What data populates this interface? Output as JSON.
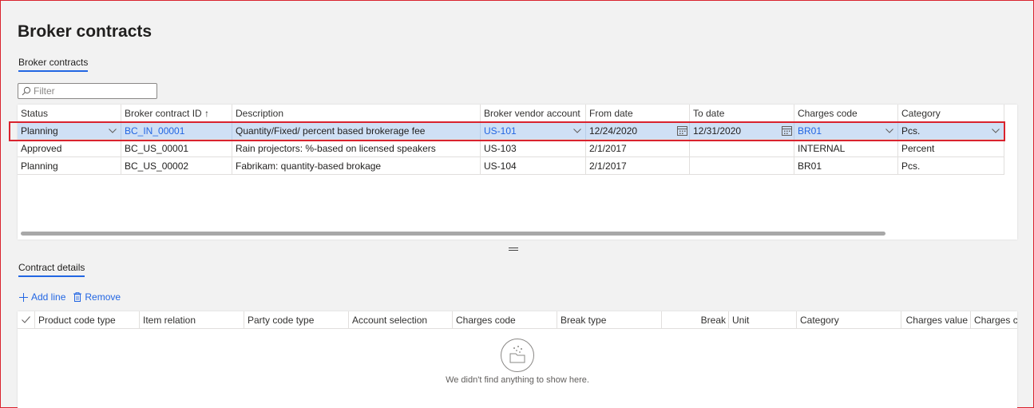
{
  "page": {
    "title": "Broker contracts"
  },
  "tabs": {
    "contracts": "Broker contracts",
    "details": "Contract details"
  },
  "filter": {
    "placeholder": "Filter"
  },
  "contracts_grid": {
    "columns": [
      "Status",
      "Broker contract ID ↑",
      "Description",
      "Broker vendor account",
      "From date",
      "To date",
      "Charges code",
      "Category"
    ],
    "rows": [
      [
        "Planning",
        "BC_IN_00001",
        "Quantity/Fixed/ percent based brokerage fee",
        "US-101",
        "12/24/2020",
        "12/31/2020",
        "BR01",
        "Pcs."
      ],
      [
        "Approved",
        "BC_US_00001",
        "Rain projectors: %-based on licensed speakers",
        "US-103",
        "2/1/2017",
        "",
        "INTERNAL",
        "Percent"
      ],
      [
        "Planning",
        "BC_US_00002",
        "Fabrikam: quantity-based brokage",
        "US-104",
        "2/1/2017",
        "",
        "BR01",
        "Pcs."
      ]
    ]
  },
  "details_toolbar": {
    "add_line": "Add line",
    "remove": "Remove"
  },
  "details_grid": {
    "columns": [
      "Product code type",
      "Item relation",
      "Party code type",
      "Account selection",
      "Charges code",
      "Break type",
      "Break",
      "Unit",
      "Category",
      "Charges value",
      "Charges cu"
    ],
    "empty_message": "We didn't find anything to show here."
  },
  "colors": {
    "accent": "#2266e3",
    "selection": "#cfe0f5",
    "highlight": "#d9232e"
  }
}
